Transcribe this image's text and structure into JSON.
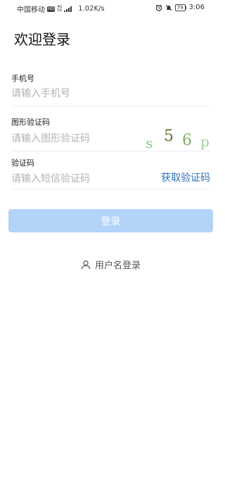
{
  "status_bar": {
    "carrier": "中国移动",
    "hd_badge": "HD",
    "net_type_top": "4G",
    "net_type_bottom": "5G",
    "speed": "1.02K/s",
    "battery_level": "79",
    "time": "3:06",
    "icons": [
      "alarm-icon",
      "mute-icon",
      "battery-icon"
    ]
  },
  "page": {
    "title": "欢迎登录"
  },
  "form": {
    "phone": {
      "label": "手机号",
      "placeholder": "请输入手机号",
      "value": ""
    },
    "captcha": {
      "label": "图形验证码",
      "placeholder": "请输入图形验证码",
      "value": "",
      "image_chars": [
        "s",
        "5",
        "6",
        "p"
      ]
    },
    "sms": {
      "label": "验证码",
      "placeholder": "请输入短信验证码",
      "value": "",
      "get_code_label": "获取验证码"
    }
  },
  "login_button": {
    "label": "登录",
    "enabled": false
  },
  "alt_login": {
    "label": "用户名登录",
    "icon": "user-icon"
  },
  "colors": {
    "accent": "#2e6fb8",
    "button_disabled_bg": "#b3d3f9",
    "placeholder": "#b3b3b3",
    "divider": "#eeeeee"
  }
}
